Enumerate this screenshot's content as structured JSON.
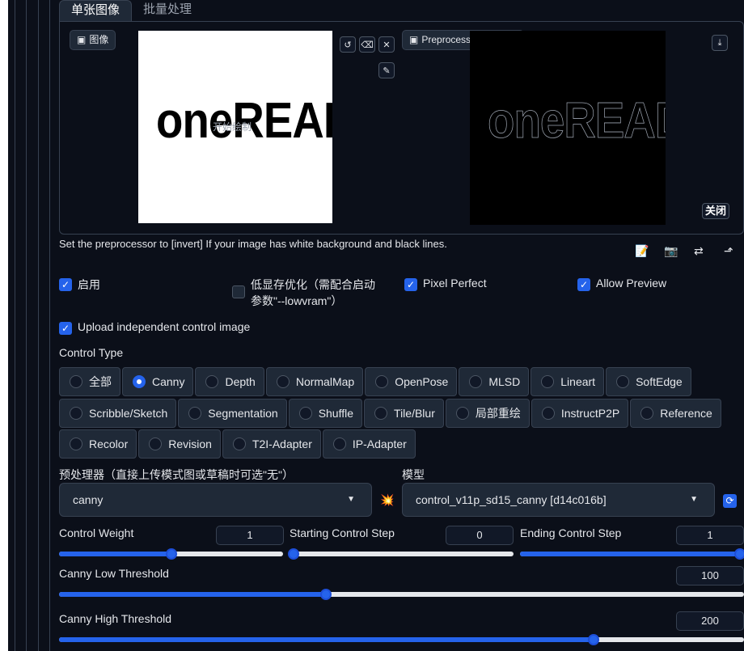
{
  "tabs": [
    "单张图像",
    "批量处理"
  ],
  "image_panel": {
    "input_label": "图像",
    "input_hint": "开始绘制",
    "logo_text": "oneREAD",
    "preview_label": "Preprocessor Preview",
    "close_label": "关闭"
  },
  "note": "Set the preprocessor to [invert] If your image has white background and black lines.",
  "checkboxes": {
    "enable": "启用",
    "lowvram_line1": "低显存优化（需配合启动",
    "lowvram_line2": "参数\"--lowvram\"）",
    "pixel_perfect": "Pixel Perfect",
    "allow_preview": "Allow Preview",
    "upload_independent": "Upload independent control image"
  },
  "control_type": {
    "label": "Control Type",
    "selected": "Canny",
    "options": [
      [
        "全部",
        "Canny",
        "Depth",
        "NormalMap",
        "OpenPose",
        "MLSD",
        "Lineart",
        "SoftEdge"
      ],
      [
        "Scribble/Sketch",
        "Segmentation",
        "Shuffle",
        "Tile/Blur",
        "局部重绘",
        "InstructP2P",
        "Reference"
      ],
      [
        "Recolor",
        "Revision",
        "T2I-Adapter",
        "IP-Adapter"
      ]
    ]
  },
  "preprocessor": {
    "label": "预处理器（直接上传模式图或草稿时可选\"无\"）",
    "value": "canny"
  },
  "model": {
    "label": "模型",
    "value": "control_v11p_sd15_canny [d14c016b]"
  },
  "sliders": {
    "control_weight": {
      "label": "Control Weight",
      "value": "1",
      "fraction": 0.5
    },
    "starting_step": {
      "label": "Starting Control Step",
      "value": "0",
      "fraction": 0.0
    },
    "ending_step": {
      "label": "Ending Control Step",
      "value": "1",
      "fraction": 1.0
    },
    "low_threshold": {
      "label": "Canny Low Threshold",
      "value": "100",
      "fraction": 0.39
    },
    "high_threshold": {
      "label": "Canny High Threshold",
      "value": "200",
      "fraction": 0.78
    }
  },
  "colors": {
    "accent": "#2563eb",
    "background": "#0b0f19",
    "panel": "#1f2937"
  }
}
